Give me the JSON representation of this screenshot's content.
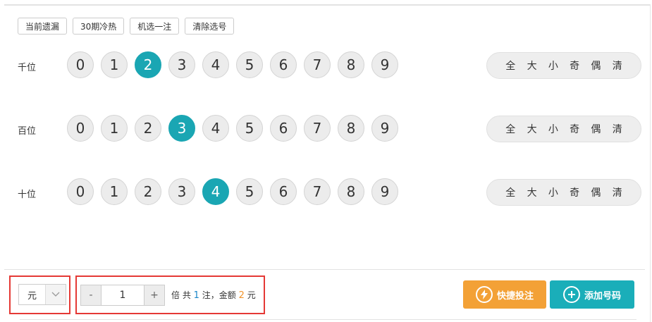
{
  "toolbar": {
    "buttons": [
      "当前遗漏",
      "30期冷热",
      "机选一注",
      "清除选号"
    ]
  },
  "rows": [
    {
      "label": "千位",
      "numbers": [
        "0",
        "1",
        "2",
        "3",
        "4",
        "5",
        "6",
        "7",
        "8",
        "9"
      ],
      "selected": "2"
    },
    {
      "label": "百位",
      "numbers": [
        "0",
        "1",
        "2",
        "3",
        "4",
        "5",
        "6",
        "7",
        "8",
        "9"
      ],
      "selected": "3"
    },
    {
      "label": "十位",
      "numbers": [
        "0",
        "1",
        "2",
        "3",
        "4",
        "5",
        "6",
        "7",
        "8",
        "9"
      ],
      "selected": "4"
    }
  ],
  "filters": [
    "全",
    "大",
    "小",
    "奇",
    "偶",
    "清"
  ],
  "unit": {
    "selected": "元"
  },
  "multiplier": {
    "minus": "-",
    "plus": "+",
    "value": "1",
    "suffix": "倍 共",
    "count": "1",
    "count_unit": "注，金额",
    "amount": "2",
    "amount_unit": "元"
  },
  "actions": {
    "quick_bet": "快捷投注",
    "add_number": "添加号码"
  },
  "colors": {
    "selected_ball": "#1aa6b3",
    "quick_bet": "#f3a136",
    "add_number": "#1aaeb9",
    "highlight_box": "#e53935"
  }
}
